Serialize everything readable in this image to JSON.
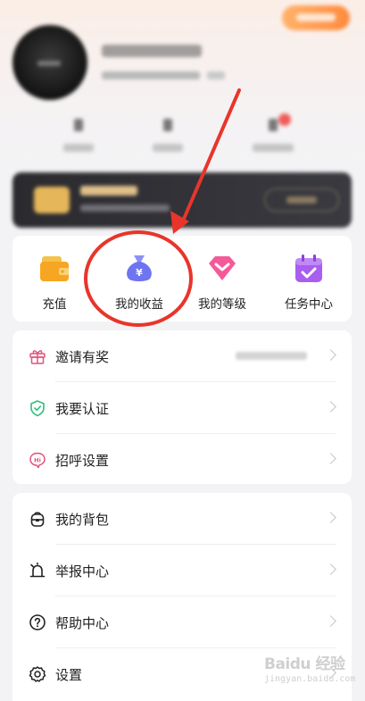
{
  "quick_actions": [
    {
      "label": "充值",
      "icon": "wallet-icon",
      "color": "#f6a623"
    },
    {
      "label": "我的收益",
      "icon": "money-bag-icon",
      "color": "#6f74f0",
      "symbol": "¥"
    },
    {
      "label": "我的等级",
      "icon": "level-diamond-icon",
      "color": "#f45a9a"
    },
    {
      "label": "任务中心",
      "icon": "calendar-check-icon",
      "color": "#a95ef0"
    }
  ],
  "menu_group1": [
    {
      "label": "邀请有奖",
      "icon": "gift-icon"
    },
    {
      "label": "我要认证",
      "icon": "shield-check-icon"
    },
    {
      "label": "招呼设置",
      "icon": "hi-bubble-icon",
      "badge_text": "Hi"
    }
  ],
  "menu_group2": [
    {
      "label": "我的背包",
      "icon": "backpack-icon"
    },
    {
      "label": "举报中心",
      "icon": "alarm-bell-icon"
    },
    {
      "label": "帮助中心",
      "icon": "help-circle-icon"
    },
    {
      "label": "设置",
      "icon": "gear-icon"
    }
  ],
  "watermark": {
    "brand": "Baidu 经验",
    "url": "jingyan.baidu.com"
  },
  "colors": {
    "annotation": "#e8352b",
    "background": "#f3f3f5"
  }
}
